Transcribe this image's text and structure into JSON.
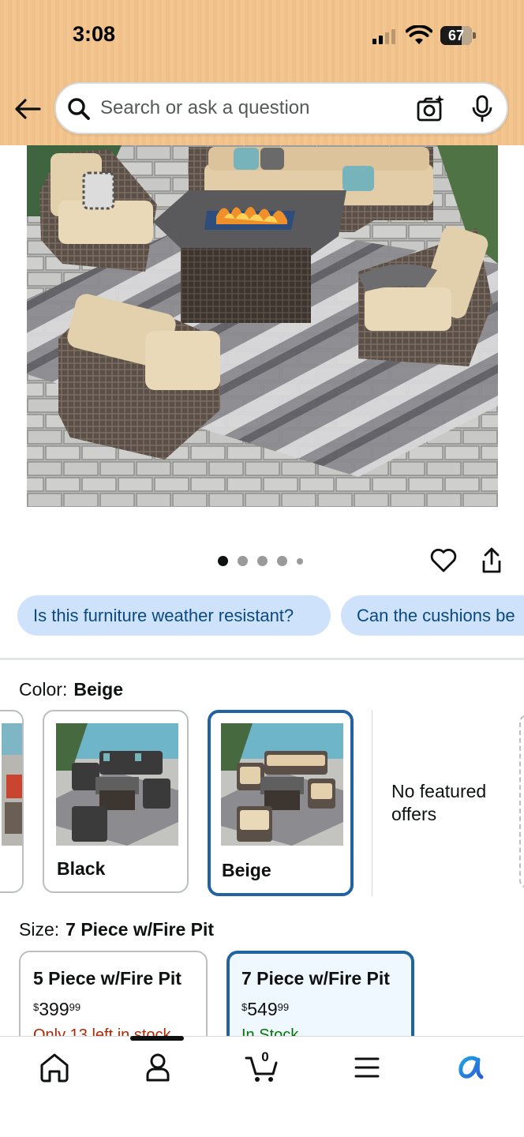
{
  "status_bar": {
    "time": "3:08",
    "battery_level": "67",
    "battery_fraction": 0.67
  },
  "header": {
    "back_icon": "arrow-left-icon",
    "search_placeholder": "Search or ask a question",
    "camera_icon": "camera-scan-icon",
    "mic_icon": "microphone-icon"
  },
  "image_gallery": {
    "image_count": 5,
    "active_index": 0
  },
  "actions": {
    "like_icon": "heart-icon",
    "share_icon": "share-icon"
  },
  "questions": [
    "Is this furniture weather resistant?",
    "Can the cushions be"
  ],
  "color": {
    "label": "Color:",
    "selected": "Beige",
    "options": [
      "Black",
      "Beige"
    ],
    "no_offers_text": "No featured offers"
  },
  "size": {
    "label": "Size:",
    "selected": "7 Piece w/Fire Pit",
    "options": [
      {
        "name": "5 Piece w/Fire Pit",
        "currency": "$",
        "price_whole": "399",
        "price_fraction": "99",
        "stock": "Only 13 left in stock"
      },
      {
        "name": "7 Piece w/Fire Pit",
        "currency": "$",
        "price_whole": "549",
        "price_fraction": "99",
        "stock": "In Stock"
      }
    ]
  },
  "tabbar": {
    "items": [
      "home-icon",
      "account-icon",
      "cart-icon",
      "menu-icon",
      "rufus-icon"
    ],
    "cart_count": "0"
  },
  "colors": {
    "header_bg": "#f3c690",
    "chip_bg": "#cfe2fb",
    "chip_text": "#0a4a82",
    "selected_border": "#2162a1",
    "low_stock": "#b12704",
    "in_stock": "#007600"
  }
}
